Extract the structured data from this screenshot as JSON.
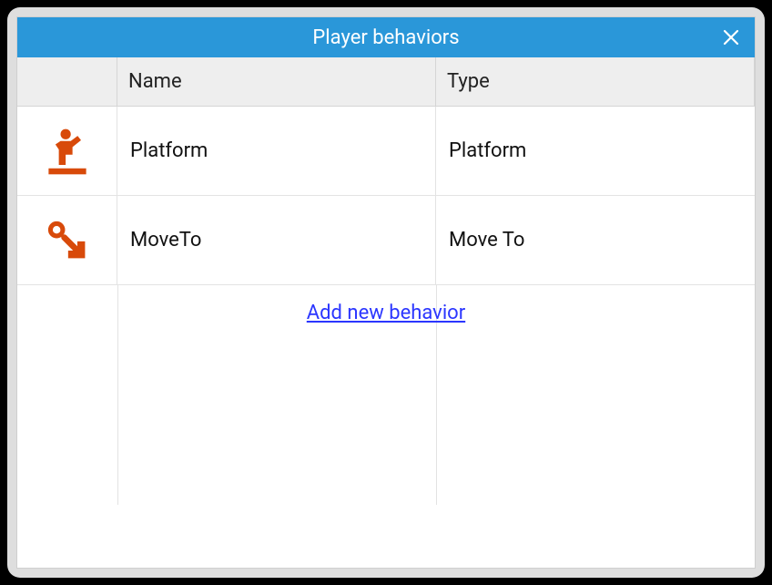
{
  "titlebar": {
    "title": "Player behaviors"
  },
  "columns": {
    "icon": "",
    "name": "Name",
    "type": "Type"
  },
  "rows": [
    {
      "icon": "platformer-icon",
      "name": "Platform",
      "type": "Platform"
    },
    {
      "icon": "moveto-icon",
      "name": "MoveTo",
      "type": "Move To"
    }
  ],
  "actions": {
    "add_label": "Add new behavior"
  },
  "colors": {
    "accent": "#2a97d9",
    "icon": "#d84a0a",
    "link": "#2b36ff"
  }
}
